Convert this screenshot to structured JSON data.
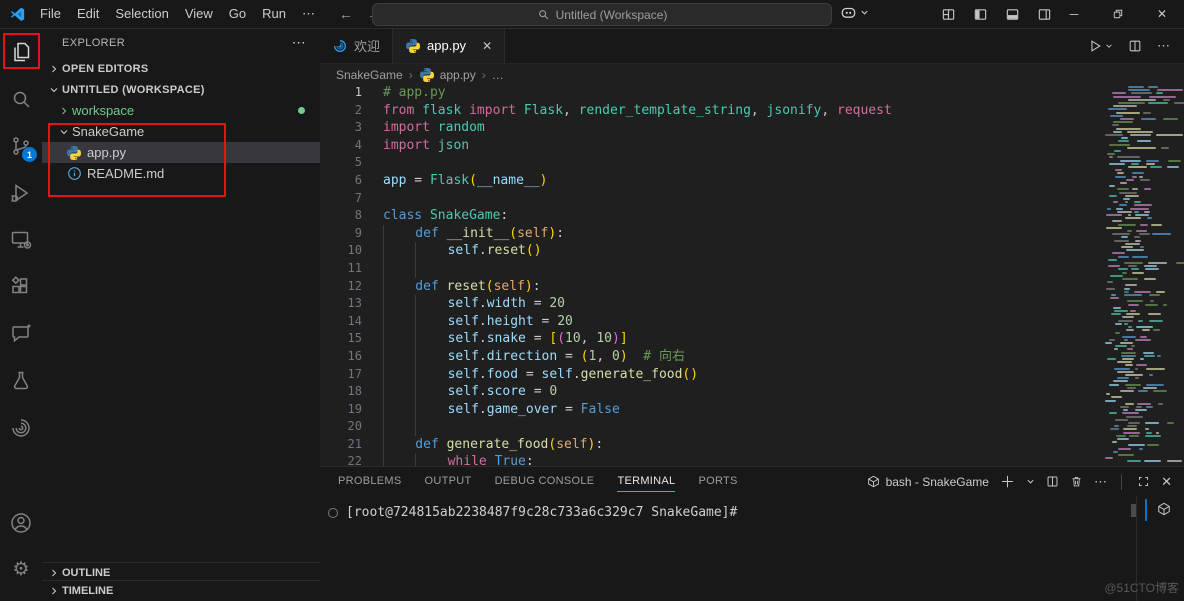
{
  "titlebar": {
    "menus": [
      "File",
      "Edit",
      "Selection",
      "View",
      "Go",
      "Run",
      "⋯"
    ],
    "command_center": "Untitled (Workspace)"
  },
  "activity_bar": {
    "top": [
      {
        "name": "explorer",
        "active": true
      },
      {
        "name": "search"
      },
      {
        "name": "source-control",
        "badge": "1"
      },
      {
        "name": "run-debug"
      },
      {
        "name": "remote-explorer"
      },
      {
        "name": "extensions"
      },
      {
        "name": "chat"
      },
      {
        "name": "testing"
      },
      {
        "name": "swirl"
      }
    ],
    "bottom": [
      {
        "name": "account"
      },
      {
        "name": "settings"
      }
    ]
  },
  "sidebar": {
    "title": "EXPLORER",
    "rows": [
      {
        "kind": "section",
        "label": "OPEN EDITORS",
        "expanded": false
      },
      {
        "kind": "section",
        "label": "UNTITLED (WORKSPACE)",
        "expanded": true
      },
      {
        "kind": "folder",
        "label": "workspace",
        "expanded": false,
        "color": "#73C991",
        "dot": true,
        "indent": 1
      },
      {
        "kind": "folder",
        "label": "SnakeGame",
        "expanded": true,
        "indent": 1
      },
      {
        "kind": "file",
        "icon": "python",
        "label": "app.py",
        "selected": true,
        "indent": 2
      },
      {
        "kind": "file",
        "icon": "info",
        "label": "README.md",
        "indent": 2
      }
    ],
    "outline": "OUTLINE",
    "timeline": "TIMELINE"
  },
  "editor": {
    "tabs": [
      {
        "label": "欢迎",
        "icon": "swirl-color",
        "active": false
      },
      {
        "label": "app.py",
        "icon": "python",
        "active": true,
        "close": true
      }
    ],
    "breadcrumb": [
      {
        "label": "SnakeGame"
      },
      {
        "label": "app.py",
        "icon": "python"
      },
      {
        "label": "…"
      }
    ],
    "code": {
      "current_line": 1,
      "lines": [
        {
          "g": 0,
          "t": [
            [
              "c",
              "# app.py"
            ]
          ]
        },
        {
          "g": 0,
          "t": [
            [
              "k",
              "from"
            ],
            [
              "p",
              " "
            ],
            [
              "t",
              "flask"
            ],
            [
              "p",
              " "
            ],
            [
              "k",
              "import"
            ],
            [
              "p",
              " "
            ],
            [
              "t",
              "Flask"
            ],
            [
              "p",
              ", "
            ],
            [
              "t",
              "render_template_string"
            ],
            [
              "p",
              ", "
            ],
            [
              "t",
              "jsonify"
            ],
            [
              "p",
              ", "
            ],
            [
              "k",
              "request"
            ]
          ]
        },
        {
          "g": 0,
          "t": [
            [
              "k",
              "import"
            ],
            [
              "p",
              " "
            ],
            [
              "t",
              "random"
            ]
          ]
        },
        {
          "g": 0,
          "t": [
            [
              "k",
              "import"
            ],
            [
              "p",
              " "
            ],
            [
              "t",
              "json"
            ]
          ]
        },
        {
          "g": 0,
          "t": []
        },
        {
          "g": 0,
          "t": [
            [
              "v",
              "app"
            ],
            [
              "p",
              " = "
            ],
            [
              "t",
              "Flask"
            ],
            [
              "b1",
              "("
            ],
            [
              "v",
              "__name__"
            ],
            [
              "b1",
              ")"
            ]
          ]
        },
        {
          "g": 0,
          "t": []
        },
        {
          "g": 0,
          "t": [
            [
              "kb",
              "class"
            ],
            [
              "p",
              " "
            ],
            [
              "t",
              "SnakeGame"
            ],
            [
              "p",
              ":"
            ]
          ]
        },
        {
          "g": 1,
          "t": [
            [
              "kb",
              "def"
            ],
            [
              "p",
              " "
            ],
            [
              "fn",
              "__init__"
            ],
            [
              "b1",
              "("
            ],
            [
              "sf",
              "self"
            ],
            [
              "b1",
              ")"
            ],
            [
              "p",
              ":"
            ]
          ]
        },
        {
          "g": 2,
          "t": [
            [
              "v",
              "self"
            ],
            [
              "p",
              "."
            ],
            [
              "fn",
              "reset"
            ],
            [
              "b1",
              "()"
            ]
          ]
        },
        {
          "g": 2,
          "t": []
        },
        {
          "g": 1,
          "t": [
            [
              "kb",
              "def"
            ],
            [
              "p",
              " "
            ],
            [
              "fn",
              "reset"
            ],
            [
              "b1",
              "("
            ],
            [
              "sf",
              "self"
            ],
            [
              "b1",
              ")"
            ],
            [
              "p",
              ":"
            ]
          ]
        },
        {
          "g": 2,
          "t": [
            [
              "v",
              "self"
            ],
            [
              "p",
              "."
            ],
            [
              "v",
              "width"
            ],
            [
              "p",
              " = "
            ],
            [
              "n",
              "20"
            ]
          ]
        },
        {
          "g": 2,
          "t": [
            [
              "v",
              "self"
            ],
            [
              "p",
              "."
            ],
            [
              "v",
              "height"
            ],
            [
              "p",
              " = "
            ],
            [
              "n",
              "20"
            ]
          ]
        },
        {
          "g": 2,
          "t": [
            [
              "v",
              "self"
            ],
            [
              "p",
              "."
            ],
            [
              "v",
              "snake"
            ],
            [
              "p",
              " = "
            ],
            [
              "b1",
              "["
            ],
            [
              "b2",
              "("
            ],
            [
              "n",
              "10"
            ],
            [
              "p",
              ", "
            ],
            [
              "n",
              "10"
            ],
            [
              "b2",
              ")"
            ],
            [
              "b1",
              "]"
            ]
          ]
        },
        {
          "g": 2,
          "t": [
            [
              "v",
              "self"
            ],
            [
              "p",
              "."
            ],
            [
              "v",
              "direction"
            ],
            [
              "p",
              " = "
            ],
            [
              "b1",
              "("
            ],
            [
              "n",
              "1"
            ],
            [
              "p",
              ", "
            ],
            [
              "n",
              "0"
            ],
            [
              "b1",
              ")"
            ],
            [
              "p",
              "  "
            ],
            [
              "c",
              "# 向右"
            ]
          ]
        },
        {
          "g": 2,
          "t": [
            [
              "v",
              "self"
            ],
            [
              "p",
              "."
            ],
            [
              "v",
              "food"
            ],
            [
              "p",
              " = "
            ],
            [
              "v",
              "self"
            ],
            [
              "p",
              "."
            ],
            [
              "fn",
              "generate_food"
            ],
            [
              "b1",
              "()"
            ]
          ]
        },
        {
          "g": 2,
          "t": [
            [
              "v",
              "self"
            ],
            [
              "p",
              "."
            ],
            [
              "v",
              "score"
            ],
            [
              "p",
              " = "
            ],
            [
              "n",
              "0"
            ]
          ]
        },
        {
          "g": 2,
          "t": [
            [
              "v",
              "self"
            ],
            [
              "p",
              "."
            ],
            [
              "v",
              "game_over"
            ],
            [
              "p",
              " = "
            ],
            [
              "kb",
              "False"
            ]
          ]
        },
        {
          "g": 2,
          "t": []
        },
        {
          "g": 1,
          "t": [
            [
              "kb",
              "def"
            ],
            [
              "p",
              " "
            ],
            [
              "fn",
              "generate_food"
            ],
            [
              "b1",
              "("
            ],
            [
              "sf",
              "self"
            ],
            [
              "b1",
              ")"
            ],
            [
              "p",
              ":"
            ]
          ]
        },
        {
          "g": 2,
          "t": [
            [
              "k",
              "while"
            ],
            [
              "p",
              " "
            ],
            [
              "kb",
              "True"
            ],
            [
              "p",
              ":"
            ]
          ]
        }
      ]
    }
  },
  "panel": {
    "tabs": [
      {
        "label": "PROBLEMS"
      },
      {
        "label": "OUTPUT"
      },
      {
        "label": "DEBUG CONSOLE"
      },
      {
        "label": "TERMINAL",
        "active": true
      },
      {
        "label": "PORTS"
      }
    ],
    "session": "bash - SnakeGame",
    "prompt": "[root@724815ab2238487f9c28c733a6c329c7 SnakeGame]#"
  },
  "watermark": "@51CTO博客",
  "colors": {
    "accent": "#0078D4",
    "git_added": "#73C991",
    "annotation": "#E51313",
    "editor_bg": "#1F1F1F",
    "chrome_bg": "#181818"
  },
  "minimap": {
    "rows": 118,
    "palette": [
      "#6A9955",
      "#C586C0",
      "#4EC9B0",
      "#DCDCAA",
      "#9CDCFE",
      "#CCCCCC",
      "#569CD6",
      "#808080"
    ]
  }
}
